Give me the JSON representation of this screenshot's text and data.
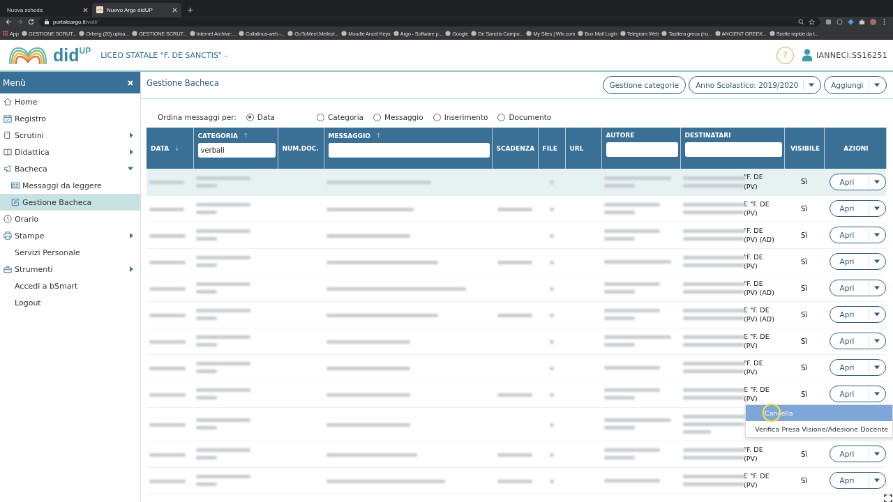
{
  "browser": {
    "tabs": [
      {
        "title": "Nuova scheda",
        "selected": false
      },
      {
        "title": "Nuovo Argo didUP",
        "selected": true
      }
    ],
    "url": {
      "host": "portaleargo.it",
      "path": "/voti/"
    },
    "bookmarks": [
      "App",
      "GESTIONE SCRUT...",
      "Orberg (20) uploa...",
      "GESTIONE SCRUT...",
      "Internet Archive:...",
      "Collatinus-web -...",
      "GoToMeet.Me/lezi...",
      "Moodle Ancel Keys",
      "Argo - Software p...",
      "Google",
      "De Sanctis Campu...",
      "My Sites | Wix.com",
      "Box Mail Login",
      "Telegram Web",
      "Tastiera greca (no...",
      "ANCIENT GREEK...",
      "Scelte rapide da t..."
    ]
  },
  "header": {
    "brand": "did",
    "brand_sup": "UP",
    "school": "LICEO STATALE \"F. DE SANCTIS\" -",
    "help": "?",
    "user": "IANNECI.SS16251"
  },
  "sidebar": {
    "title": "Menù",
    "items": [
      {
        "label": "Home",
        "selected": false
      },
      {
        "label": "Registro",
        "selected": false
      },
      {
        "label": "Scrutini",
        "expanded": false,
        "selected": false
      },
      {
        "label": "Didattica",
        "expanded": false,
        "selected": false
      },
      {
        "label": "Bacheca",
        "expanded": true,
        "selected": false,
        "children": [
          {
            "label": "Messaggi da leggere",
            "selected": false
          },
          {
            "label": "Gestione Bacheca",
            "selected": true
          }
        ]
      },
      {
        "label": "Orario",
        "selected": false
      },
      {
        "label": "Stampe",
        "expanded": false,
        "selected": false
      },
      {
        "label": "Servizi Personale",
        "selected": false
      },
      {
        "label": "Strumenti",
        "expanded": false,
        "selected": false
      },
      {
        "label": "Accedi a bSmart",
        "selected": false
      },
      {
        "label": "Logout",
        "selected": false
      }
    ]
  },
  "page": {
    "title": "Gestione Bacheca",
    "buttons": [
      {
        "label": "Gestione categorie",
        "dropdown": false
      },
      {
        "label": "Anno Scolastico: 2019/2020",
        "dropdown": true
      },
      {
        "label": "Aggiungi",
        "dropdown": true
      }
    ]
  },
  "sort": {
    "label": "Ordina messaggi per:",
    "options": [
      {
        "label": "Data",
        "selected": true
      },
      {
        "label": "Categoria",
        "selected": false
      },
      {
        "label": "Messaggio",
        "selected": false
      },
      {
        "label": "Inserimento",
        "selected": false
      },
      {
        "label": "Documento",
        "selected": false
      }
    ]
  },
  "table": {
    "columns": [
      {
        "label": "DATA",
        "sort_mark": "↓",
        "filterable": false
      },
      {
        "label": "CATEGORIA",
        "sort_mark": "↑",
        "filterable": true,
        "filter_value": "verbali"
      },
      {
        "label": "NUM.DOC.",
        "filterable": false
      },
      {
        "label": "MESSAGGIO",
        "sort_mark": "↑",
        "filterable": true
      },
      {
        "label": "SCADENZA",
        "filterable": false
      },
      {
        "label": "FILE",
        "filterable": false
      },
      {
        "label": "URL",
        "filterable": false
      },
      {
        "label": "AUTORE",
        "filterable": true
      },
      {
        "label": "DESTINATARI",
        "filterable": true
      },
      {
        "label": "VISIBILE",
        "filterable": false
      },
      {
        "label": "AZIONI",
        "filterable": false
      }
    ],
    "rows": [
      {
        "selected": true,
        "destinatari": [
          "\"F. DE",
          "(PV)"
        ],
        "visibile": "Sì",
        "action": "Apri"
      },
      {
        "selected": false,
        "destinatari": [
          "E \"F. DE",
          "(PV)"
        ],
        "visibile": "Sì",
        "action": "Apri"
      },
      {
        "selected": false,
        "destinatari": [
          "\"F. DE",
          "(PV) (AD)"
        ],
        "visibile": "Sì",
        "action": "Apri"
      },
      {
        "selected": false,
        "destinatari": [
          "\"F. DE",
          "(PV)"
        ],
        "visibile": "Sì",
        "action": "Apri"
      },
      {
        "selected": false,
        "destinatari": [
          "\"F. DE",
          "(PV) (AD)"
        ],
        "visibile": "Sì",
        "action": "Apri"
      },
      {
        "selected": false,
        "destinatari": [
          "E \"F. DE",
          "(PV) (AD)"
        ],
        "visibile": "Sì",
        "action": "Apri"
      },
      {
        "selected": false,
        "destinatari": [
          "E \"F. DE",
          "(PV)"
        ],
        "visibile": "Sì",
        "action": "Apri"
      },
      {
        "selected": false,
        "destinatari": [
          "\"F. DE",
          "(PV)"
        ],
        "visibile": "Sì",
        "action": "Apri"
      },
      {
        "selected": false,
        "destinatari": [
          "E \"F. DE",
          "(PV)"
        ],
        "visibile": "Sì",
        "action": "Apri",
        "menu": [
          {
            "label": "Cancella",
            "selected": true
          },
          {
            "label": "Verifica Presa Visione/Adesione Docente",
            "selected": false
          }
        ]
      },
      {
        "selected": false
      },
      {
        "selected": false,
        "destinatari": [
          "\"F. DE",
          "(PV)"
        ],
        "visibile": "Sì",
        "action": "Apri"
      },
      {
        "selected": false,
        "destinatari": [
          "E \"F. DE",
          "(PV)"
        ],
        "visibile": "Sì",
        "action": "Apri"
      }
    ]
  }
}
